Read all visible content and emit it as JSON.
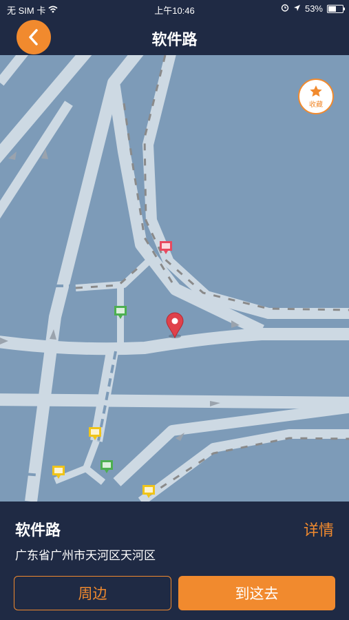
{
  "status_bar": {
    "carrier": "无 SIM 卡",
    "time": "上午10:46",
    "battery": "53%"
  },
  "nav": {
    "title": "软件路"
  },
  "map": {
    "favorite_label": "收藏"
  },
  "place": {
    "name": "软件路",
    "details_label": "详情",
    "address": "广东省广州市天河区天河区"
  },
  "actions": {
    "nearby_label": "周边",
    "go_label": "到这去"
  },
  "colors": {
    "accent": "#f18a2e",
    "panel": "#1f2a44",
    "map_background": "#7d9bb8",
    "road": "#cdd9e3",
    "pin": "#e0414b"
  }
}
